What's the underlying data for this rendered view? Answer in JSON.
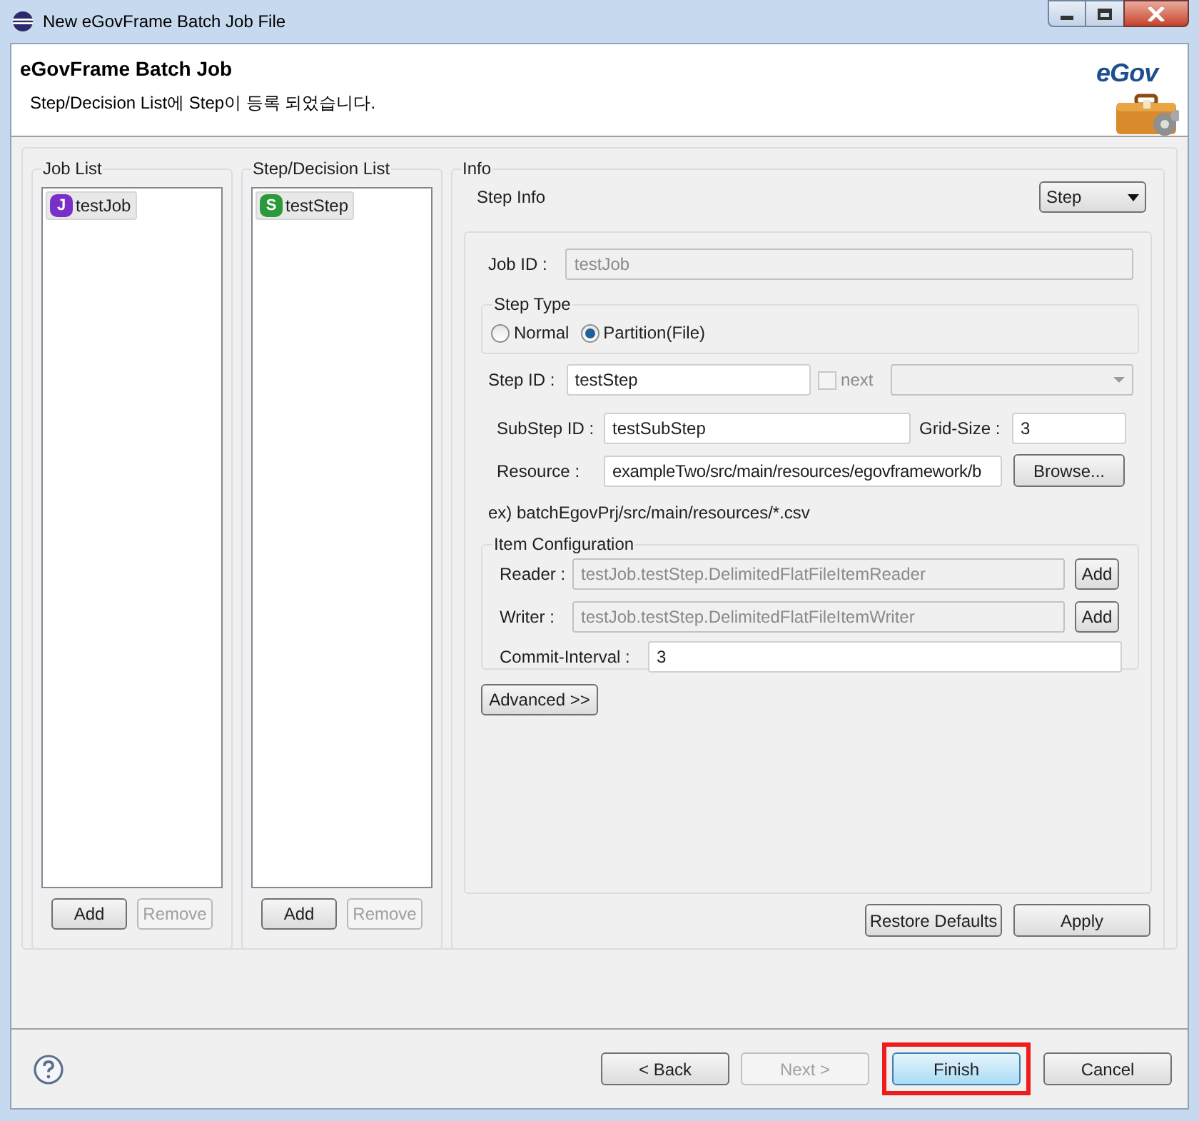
{
  "window": {
    "title": "New eGovFrame Batch Job File"
  },
  "header": {
    "title": "eGovFrame Batch Job",
    "message": "Step/Decision List에 Step이 등록 되었습니다.",
    "logo_text": "eGov"
  },
  "job_list": {
    "label": "Job List",
    "items": [
      {
        "badge": "J",
        "label": "testJob",
        "selected": true
      }
    ],
    "buttons": [
      {
        "label": "Add",
        "disabled": false
      },
      {
        "label": "Remove",
        "disabled": true
      }
    ]
  },
  "step_list": {
    "label": "Step/Decision List",
    "items": [
      {
        "badge": "S",
        "label": "testStep",
        "selected": true
      }
    ],
    "buttons": [
      {
        "label": "Add",
        "disabled": false
      },
      {
        "label": "Remove",
        "disabled": true
      }
    ]
  },
  "info": {
    "label": "Info",
    "section_label": "Step Info",
    "type_select": "Step",
    "job_id": {
      "label": "Job ID :",
      "value": "testJob",
      "disabled": true
    },
    "step_type": {
      "label": "Step Type",
      "options": [
        {
          "label": "Normal",
          "selected": false
        },
        {
          "label": "Partition(File)",
          "selected": true
        }
      ]
    },
    "step_id": {
      "label": "Step ID :",
      "value": "testStep"
    },
    "next": {
      "label": "next",
      "checked": false,
      "disabled": true
    },
    "substep_id": {
      "label": "SubStep ID :",
      "value": "testSubStep"
    },
    "grid_size": {
      "label": "Grid-Size :",
      "value": "3"
    },
    "resource": {
      "label": "Resource :",
      "value": "exampleTwo/src/main/resources/egovframework/b",
      "button": "Browse..."
    },
    "example": "ex) batchEgovPrj/src/main/resources/*.csv",
    "item_configuration": {
      "label": "Item Configuration",
      "rows": [
        {
          "label": "Reader :",
          "value": "testJob.testStep.DelimitedFlatFileItemReader",
          "disabled": true,
          "button": "Add"
        },
        {
          "label": "Writer :",
          "value": "testJob.testStep.DelimitedFlatFileItemWriter",
          "disabled": true,
          "button": "Add"
        }
      ],
      "commit_interval": {
        "label": "Commit-Interval :",
        "value": "3"
      }
    },
    "advanced_button": "Advanced >>",
    "buttons": [
      "Restore Defaults",
      "Apply"
    ]
  },
  "footer": {
    "buttons": [
      {
        "label": "< Back",
        "disabled": false,
        "default": false,
        "annotated": false
      },
      {
        "label": "Next >",
        "disabled": true,
        "default": false,
        "annotated": false
      },
      {
        "label": "Finish",
        "disabled": false,
        "default": true,
        "annotated": true
      },
      {
        "label": "Cancel",
        "disabled": false,
        "default": false,
        "annotated": false
      }
    ]
  }
}
